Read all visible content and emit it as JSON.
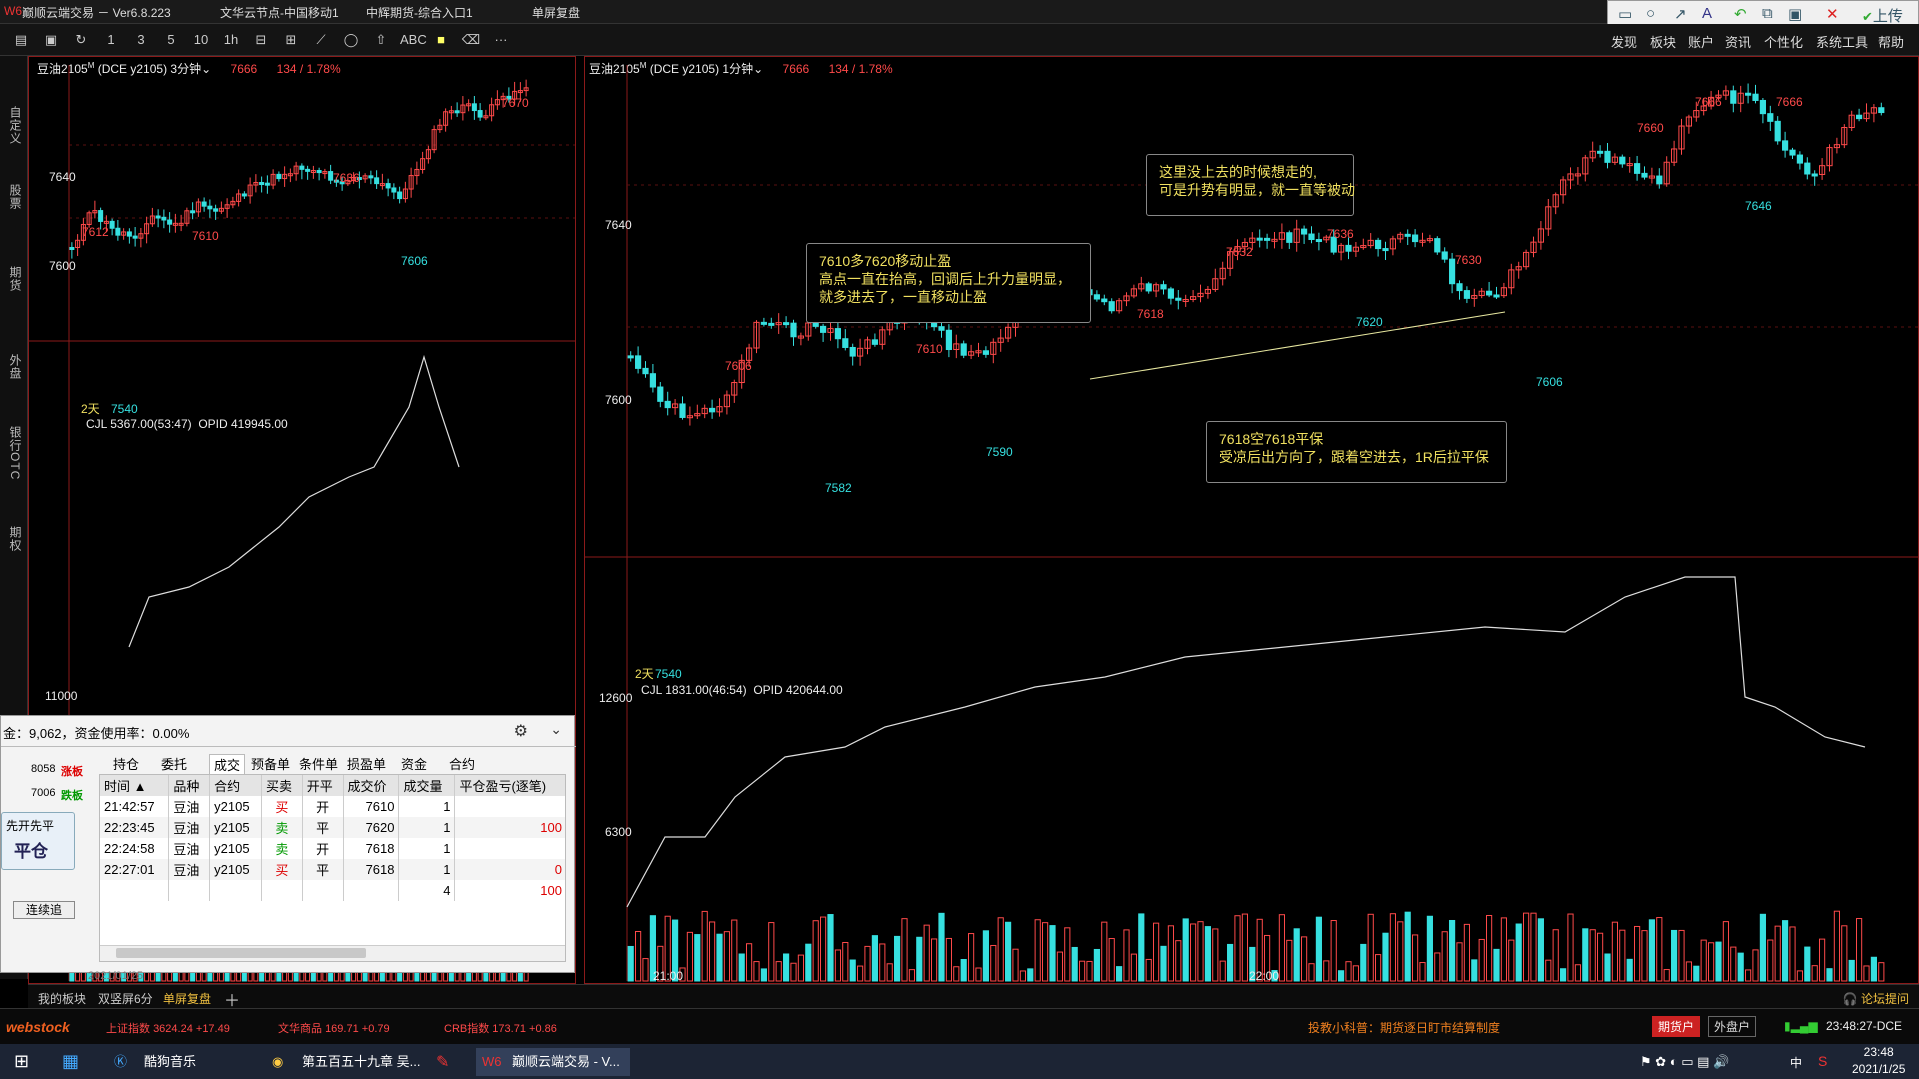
{
  "titlebar": {
    "app": "巅顺云端交易 － Ver6.8.223",
    "node": "文华云节点-中国移动1",
    "futures": "中辉期货-综合入口1",
    "mode": "单屏复盘"
  },
  "toolbar_icons": [
    "layout-icon",
    "save-icon",
    "refresh-icon",
    "1",
    "3",
    "5",
    "10",
    "1h",
    "split-icon",
    "grid-icon",
    "line-icon",
    "ellipse-icon",
    "arrow-icon",
    "ABC",
    "color-icon",
    "eraser-icon",
    "···"
  ],
  "menus": [
    "发现",
    "板块",
    "账户",
    "资讯",
    "个性化",
    "系统工具",
    "帮助"
  ],
  "upload": "上传",
  "sidebar_tabs": [
    "自定义",
    "股票",
    "期货",
    "外盘",
    "银行OTC",
    "期权"
  ],
  "left_chart": {
    "header": {
      "symbol": "豆油2105",
      "tag": "M",
      "exchange": "(DCE y2105)",
      "period": "3分钟",
      "price": "7666",
      "change": "134 / 1.78%"
    },
    "price_axis": [
      "7640",
      "7600"
    ],
    "labels_red": [
      "7612",
      "7610",
      "7636",
      "7670"
    ],
    "labels_cyan": [
      "7606",
      "7540"
    ],
    "days": "2天",
    "vol_header": {
      "name": "CJL",
      "vol": "5367.00(53:47)",
      "opid": "OPID 419945.00"
    },
    "vol_axis": "11000"
  },
  "right_chart": {
    "header": {
      "symbol": "豆油2105",
      "tag": "M",
      "exchange": "(DCE y2105)",
      "period": "1分钟",
      "price": "7666",
      "change": "134 / 1.78%"
    },
    "price_axis": [
      "7640",
      "7600"
    ],
    "labels_red": [
      "7606",
      "7610",
      "7618",
      "7632",
      "7636",
      "7630",
      "7660",
      "7666",
      "7666"
    ],
    "labels_cyan": [
      "7582",
      "7590",
      "7620",
      "7606",
      "7646",
      "7540"
    ],
    "days": "2天",
    "vol_header": {
      "name": "CJL",
      "vol": "1831.00(46:54)",
      "opid": "OPID 420644.00"
    },
    "vol_axis": [
      "12600",
      "6300"
    ],
    "time_axis": [
      "21:00",
      "22:00"
    ],
    "notes": [
      {
        "text": "这里没上去的时候想走的,\n可是升势有明显，就一直等被动"
      },
      {
        "text": "7610多7620移动止盈\n高点一直在抬高，回调后上升力量明显，\n就多进去了，一直移动止盈"
      },
      {
        "text": "7618空7618平保\n受凉后出方向了，跟着空进去，1R后拉平保"
      }
    ]
  },
  "order_panel": {
    "funds": "金：9,062，资金使用率：0.00%",
    "limit_up": {
      "price": "8058",
      "label": "涨板"
    },
    "limit_down": {
      "price": "7006",
      "label": "跌板"
    },
    "mode_btn": "先开先平",
    "close_btn": "平仓",
    "chase_btn": "连续追",
    "tabs": [
      "持仓",
      "委托",
      "成交",
      "预备单",
      "条件单",
      "损盈单",
      "资金",
      "合约"
    ],
    "active_tab": "成交",
    "columns": [
      "时间 ▲",
      "品种",
      "合约",
      "买卖",
      "开平",
      "成交价",
      "成交量",
      "平仓盈亏(逐笔)"
    ],
    "rows": [
      [
        "21:42:57",
        "豆油",
        "y2105",
        "买",
        "开",
        "7610",
        "1",
        ""
      ],
      [
        "22:23:45",
        "豆油",
        "y2105",
        "卖",
        "平",
        "7620",
        "1",
        "100"
      ],
      [
        "22:24:58",
        "豆油",
        "y2105",
        "卖",
        "开",
        "7618",
        "1",
        ""
      ],
      [
        "22:27:01",
        "豆油",
        "y2105",
        "买",
        "平",
        "7618",
        "1",
        "0"
      ],
      [
        "",
        "",
        "",
        "",
        "",
        "",
        "4",
        "100"
      ]
    ],
    "date": "2021/01/25"
  },
  "bottom_tabs": [
    "我的板块",
    "双竖屏6分",
    "单屏复盘"
  ],
  "forum": "论坛提问",
  "status": {
    "brand": "webstock",
    "sh": {
      "name": "上证指数",
      "value": "3624.24",
      "change": "+17.49"
    },
    "wh": {
      "name": "文华商品",
      "value": "169.71",
      "change": "+0.79"
    },
    "crb": {
      "name": "CRB指数",
      "value": "173.71",
      "change": "+0.86"
    },
    "tip": "投教小科普：期货逐日盯市结算制度",
    "futures_acct": "期货户",
    "outer_acct": "外盘户",
    "clock": "23:48:27-DCE"
  },
  "taskbar": {
    "apps": [
      "酷狗音乐",
      "第五百五十九章 吴...",
      "巅顺云端交易 - V..."
    ],
    "time": "23:48",
    "date": "2021/1/25",
    "ime": "中"
  },
  "colors": {
    "up": "#ff4a4a",
    "down": "#36e0e0",
    "frame": "#8b1a1a",
    "note": "#f0e060"
  }
}
